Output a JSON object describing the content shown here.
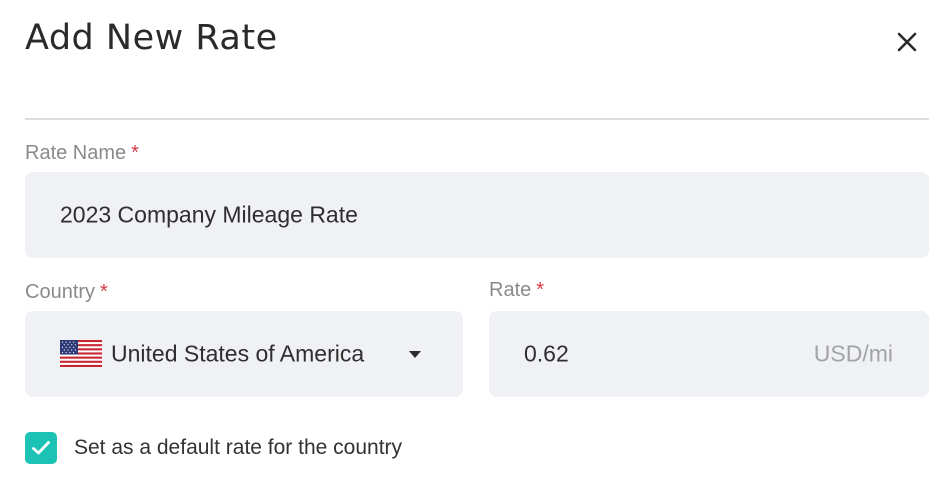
{
  "dialog": {
    "title": "Add New Rate",
    "close_icon": "close-icon"
  },
  "form": {
    "rate_name": {
      "label": "Rate Name",
      "required_mark": "*",
      "value": "2023 Company Mileage Rate"
    },
    "country": {
      "label": "Country",
      "required_mark": "*",
      "value": "United States of America",
      "flag_icon": "us-flag-icon",
      "dropdown_icon": "caret-down-icon"
    },
    "rate": {
      "label": "Rate",
      "required_mark": "*",
      "value": "0.62",
      "unit": "USD/mi"
    },
    "default_checkbox": {
      "checked": true,
      "label": "Set as a default rate for the country"
    }
  },
  "colors": {
    "accent": "#1cc2b3",
    "required": "#d23a47",
    "field_bg": "#f0f1f5"
  }
}
